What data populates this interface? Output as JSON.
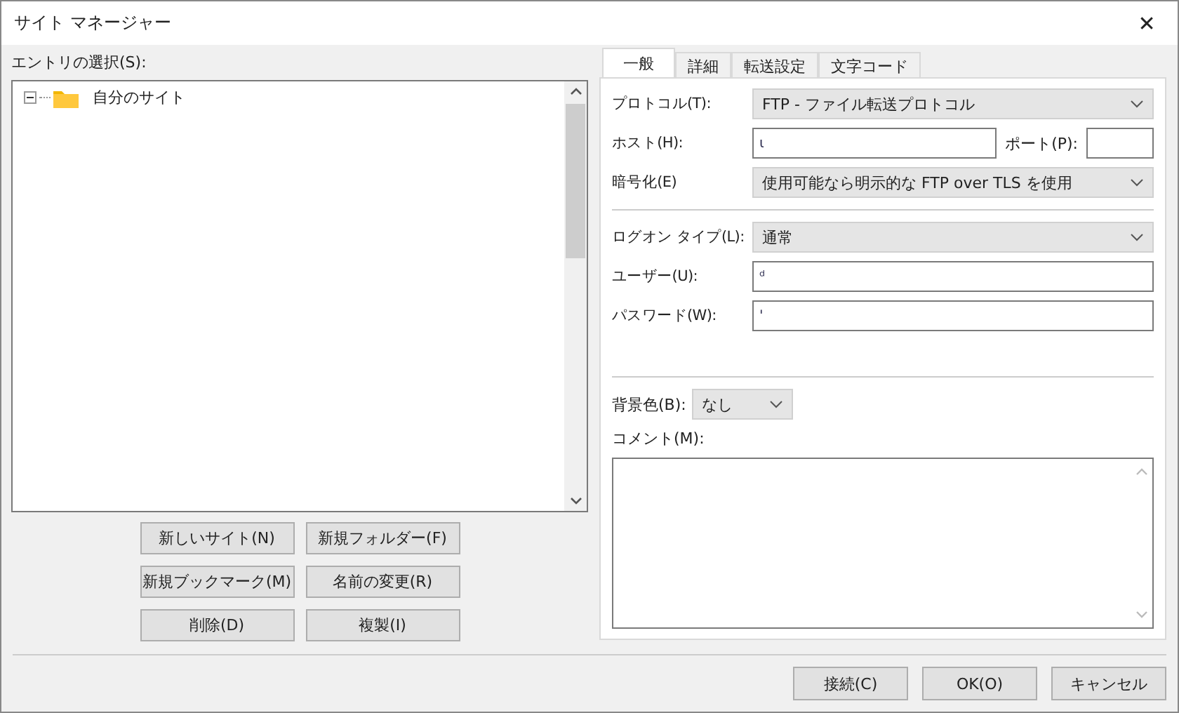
{
  "window": {
    "title": "サイト マネージャー",
    "close": "✕"
  },
  "entry_label": "エントリの選択(S):",
  "tree": [
    {
      "label": "自分のサイト",
      "expanded": true
    }
  ],
  "site_buttons": [
    {
      "label": "新しいサイト(N)"
    },
    {
      "label": "新規フォルダー(F)"
    },
    {
      "label": "新規ブックマーク(M)"
    },
    {
      "label": "名前の変更(R)"
    },
    {
      "label": "削除(D)"
    },
    {
      "label": "複製(I)"
    }
  ],
  "tabs": [
    {
      "label": "一般",
      "selected": true
    },
    {
      "label": "詳細",
      "selected": false
    },
    {
      "label": "転送設定",
      "selected": false
    },
    {
      "label": "文字コード",
      "selected": false
    }
  ],
  "protocol": {
    "label": "プロトコル(T):",
    "value": "FTP - ファイル転送プロトコル"
  },
  "host": {
    "label": "ホスト(H):",
    "value": "ι"
  },
  "port": {
    "label": "ポート(P):"
  },
  "encryption": {
    "label": "暗号化(E)",
    "value": "使用可能なら明示的な FTP over TLS を使用"
  },
  "logon_type": {
    "label": "ログオン タイプ(L):",
    "value": "通常"
  },
  "user": {
    "label": "ユーザー(U):",
    "value": "ᵈ"
  },
  "password": {
    "label": "パスワード(W):",
    "value": "'"
  },
  "background_color": {
    "label": "背景色(B):",
    "value": "なし"
  },
  "comment": {
    "label": "コメント(M):"
  },
  "dialog_buttons": [
    {
      "label": "接続(C)"
    },
    {
      "label": "OK(O)"
    },
    {
      "label": "キャンセル"
    }
  ]
}
